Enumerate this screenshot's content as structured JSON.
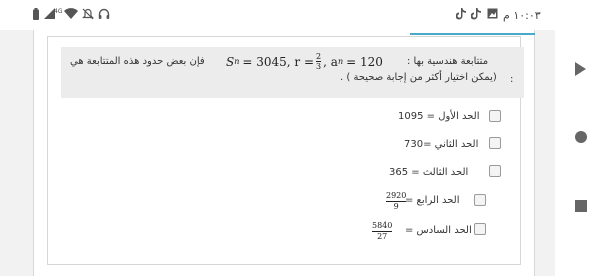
{
  "status_bar": {
    "time": "١٠:٠٣ م",
    "icons": [
      "image-icon",
      "tiktok-icon",
      "tiktok-icon",
      "headset-icon",
      "mute-icon",
      "wifi-icon",
      "signal-4g-icon",
      "signal-icon",
      "battery-icon"
    ],
    "network_label": "4G"
  },
  "question": {
    "text_intro": "متتابعة هندسية بها :",
    "math": {
      "sn_label": "S",
      "sn_sub": "n",
      "sn_value": "= 3045, r =",
      "r_num": "2",
      "r_den": "3",
      "an_label": ", a",
      "an_sub": "n",
      "an_value": "= 120"
    },
    "text_suffix": "فإن بعض حدود هذه المتتابعة هي",
    "note": "(يمكن اختيار أكثر من إجابة صحيحة ) .",
    "colon": ":"
  },
  "options": [
    {
      "label": "الحد الأول = 1095",
      "checked": false
    },
    {
      "label": "الحد الثاني =730",
      "checked": false
    },
    {
      "label": "الحد الثالث = 365",
      "checked": false
    },
    {
      "label": "الحد الرابع =",
      "frac_num": "2920",
      "frac_den": "9",
      "checked": false
    },
    {
      "label": "الحد السادس =",
      "frac_num": "5840",
      "frac_den": "27",
      "checked": false
    }
  ],
  "colors": {
    "accent": "#4aa8c9",
    "question_bg": "#ececec",
    "page_bg": "#f2f2f2"
  },
  "nav": {
    "back": "back-icon",
    "home": "home-icon",
    "recent": "recent-apps-icon"
  }
}
